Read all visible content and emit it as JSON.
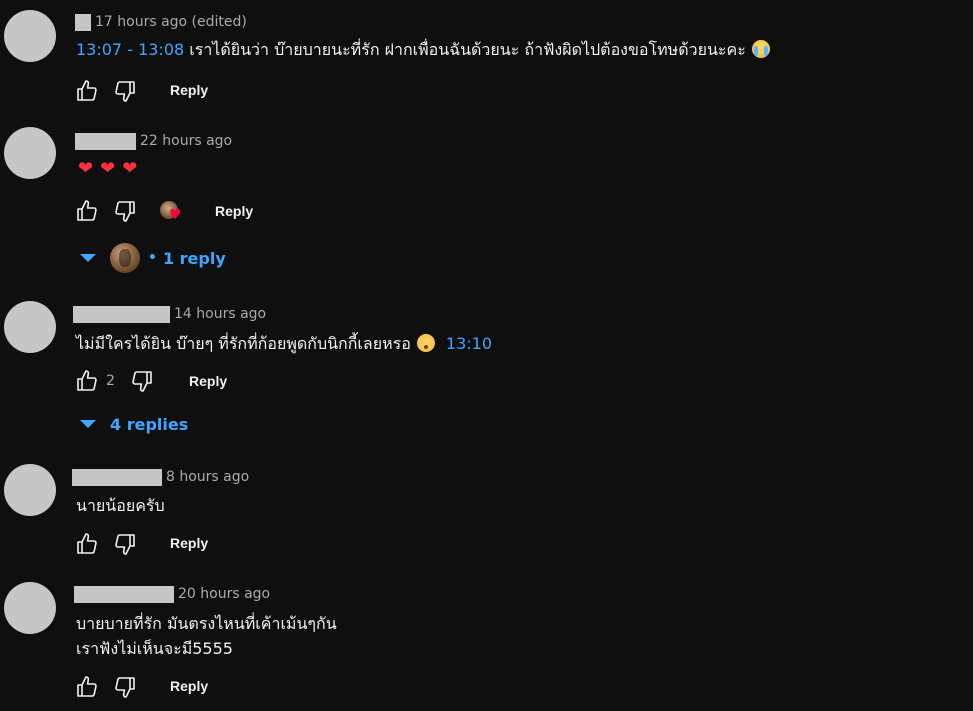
{
  "comments": [
    {
      "time": "17 hours ago (edited)",
      "ts_start": "13:07",
      "ts_sep": " - ",
      "ts_end": "13:08",
      "text": " เราได้ยินว่า บ๊ายบายนะที่รัก ฝากเพื่อนฉันด้วยนะ ถ้าฟังผิดไปต้องขอโทษด้วยนะคะ",
      "emoji": "loudly-crying-face",
      "reply_label": "Reply"
    },
    {
      "time": "22 hours ago",
      "hearts": [
        "❤",
        "❤",
        "❤"
      ],
      "reply_label": "Reply",
      "creator_heart": true,
      "replies_label": "1 reply",
      "replies_dot": "•"
    },
    {
      "time": "14 hours ago",
      "text": "ไม่มีใครได้ยิน บ๊ายๆ ที่รักที่ก้อยพูดกับนิกกี้เลยหรอ",
      "emoji": "flushed-face",
      "ts": "13:10",
      "likes": "2",
      "reply_label": "Reply",
      "replies_label": "4 replies"
    },
    {
      "time": "8 hours ago",
      "text": "นายน้อยครับ",
      "reply_label": "Reply"
    },
    {
      "time": "20 hours ago",
      "text_line1": "บายบายที่รัก มันตรงไหนที่เค้าเม้นๆกัน",
      "text_line2": "เราฟังไม่เห็นจะมี5555",
      "reply_label": "Reply"
    }
  ],
  "colors": {
    "background": "#0f0f0f",
    "text": "#f1f1f1",
    "meta": "#aaaaaa",
    "link": "#3ea6ff",
    "heart": "#ff3040"
  }
}
